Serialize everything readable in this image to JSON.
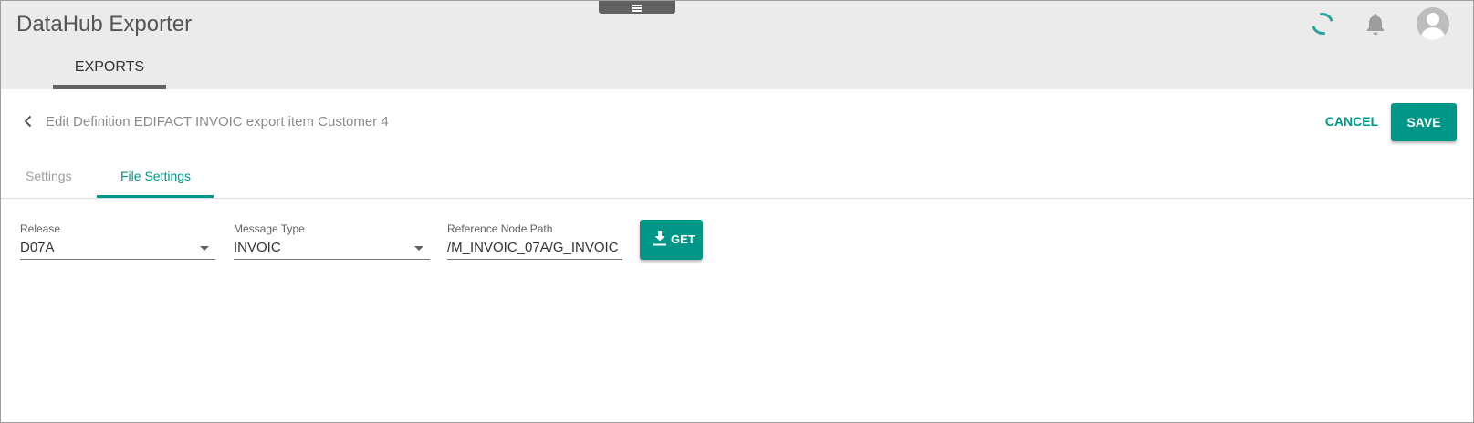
{
  "app": {
    "title": "DataHub Exporter"
  },
  "nav": {
    "tabs": [
      {
        "label": "EXPORTS",
        "active": true
      }
    ]
  },
  "header": {
    "title": "Edit Definition EDIFACT INVOIC export item Customer 4",
    "cancel_label": "CANCEL",
    "save_label": "SAVE"
  },
  "tabs": [
    {
      "label": "Settings",
      "active": false
    },
    {
      "label": "File Settings",
      "active": true
    }
  ],
  "form": {
    "release": {
      "label": "Release",
      "value": "D07A"
    },
    "message_type": {
      "label": "Message Type",
      "value": "INVOIC"
    },
    "reference_node_path": {
      "label": "Reference Node Path",
      "value": "/M_INVOIC_07A/G_INVOIC"
    },
    "get_label": "GET"
  },
  "colors": {
    "accent": "#009688",
    "appbar": "#ebebeb",
    "nav_underline": "#616161"
  }
}
